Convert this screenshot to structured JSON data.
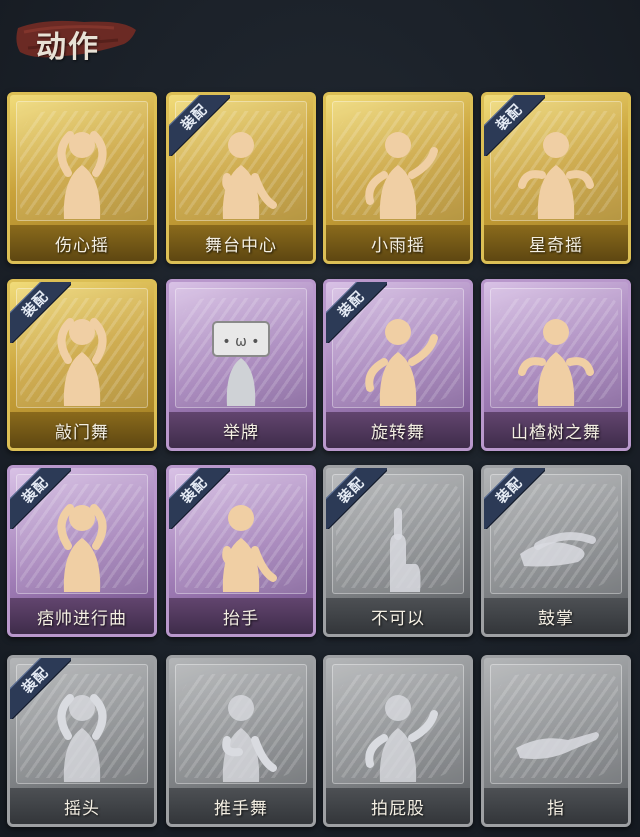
{
  "header": {
    "title": "动作"
  },
  "badge_label": "装配",
  "cards": [
    {
      "label": "伤心摇",
      "tier": "gold",
      "equipped": false
    },
    {
      "label": "舞台中心",
      "tier": "gold",
      "equipped": true
    },
    {
      "label": "小雨摇",
      "tier": "gold",
      "equipped": false
    },
    {
      "label": "星奇摇",
      "tier": "gold",
      "equipped": true
    },
    {
      "label": "敲门舞",
      "tier": "gold",
      "equipped": true
    },
    {
      "label": "举牌",
      "tier": "purple",
      "equipped": false
    },
    {
      "label": "旋转舞",
      "tier": "purple",
      "equipped": true
    },
    {
      "label": "山楂树之舞",
      "tier": "purple",
      "equipped": false
    },
    {
      "label": "痞帅进行曲",
      "tier": "purple",
      "equipped": true
    },
    {
      "label": "抬手",
      "tier": "purple",
      "equipped": true
    },
    {
      "label": "不可以",
      "tier": "gray",
      "equipped": true
    },
    {
      "label": "鼓掌",
      "tier": "gray",
      "equipped": true
    },
    {
      "label": "摇头",
      "tier": "gray",
      "equipped": true
    },
    {
      "label": "推手舞",
      "tier": "gray",
      "equipped": false
    },
    {
      "label": "拍屁股",
      "tier": "gray",
      "equipped": false
    },
    {
      "label": "指",
      "tier": "gray",
      "equipped": false
    }
  ],
  "icons": [
    "heart-shake-figure-icon",
    "stage-center-figure-icon",
    "rain-shake-figure-icon",
    "star-shake-figure-icon",
    "knock-dance-figure-icon",
    "hold-sign-figure-icon",
    "spin-dance-figure-icon",
    "hawthorn-dance-figure-icon",
    "cool-march-figure-icon",
    "raise-hand-figure-icon",
    "no-finger-icon",
    "clap-hands-icon",
    "shake-head-figure-icon",
    "push-dance-figure-icon",
    "pat-butt-figure-icon",
    "point-hand-icon"
  ],
  "colors": {
    "gold": "#c9a23a",
    "purple": "#a27fb8",
    "gray": "#85888b",
    "badge": "#2c3a56",
    "header_brush": "#6b2a24"
  }
}
